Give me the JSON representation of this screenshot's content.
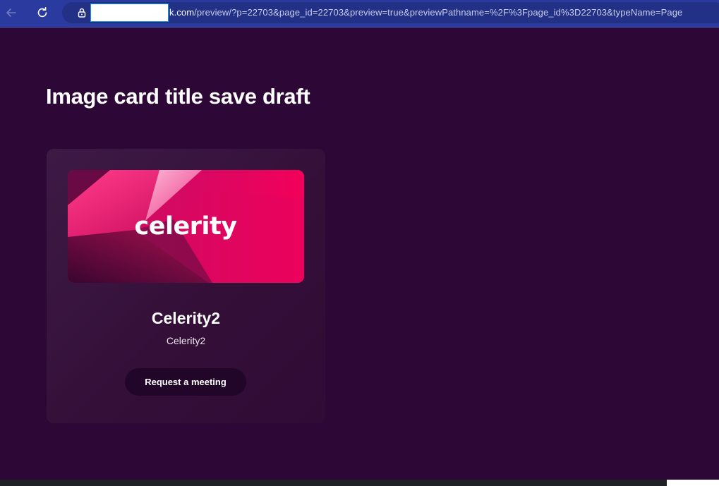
{
  "browser": {
    "url_host": "k.com",
    "url_path": "/preview/?p=22703&page_id=22703&preview=true&previewPathname=%2F%3Fpage_id%3D22703&typeName=Page"
  },
  "page": {
    "title": "Image card title save draft"
  },
  "card": {
    "image_logo_text": "celerity",
    "title": "Celerity2",
    "subtitle": "Celerity2",
    "button_label": "Request a meeting"
  },
  "colors": {
    "page_background": "#2d0735",
    "browser_bar": "#2a3a9e",
    "card_background": "#361139",
    "button_background": "#22062a",
    "brand_pink": "#e8005e"
  },
  "icons": {
    "back": "back-arrow-icon",
    "reload": "reload-icon",
    "lock": "lock-icon"
  }
}
